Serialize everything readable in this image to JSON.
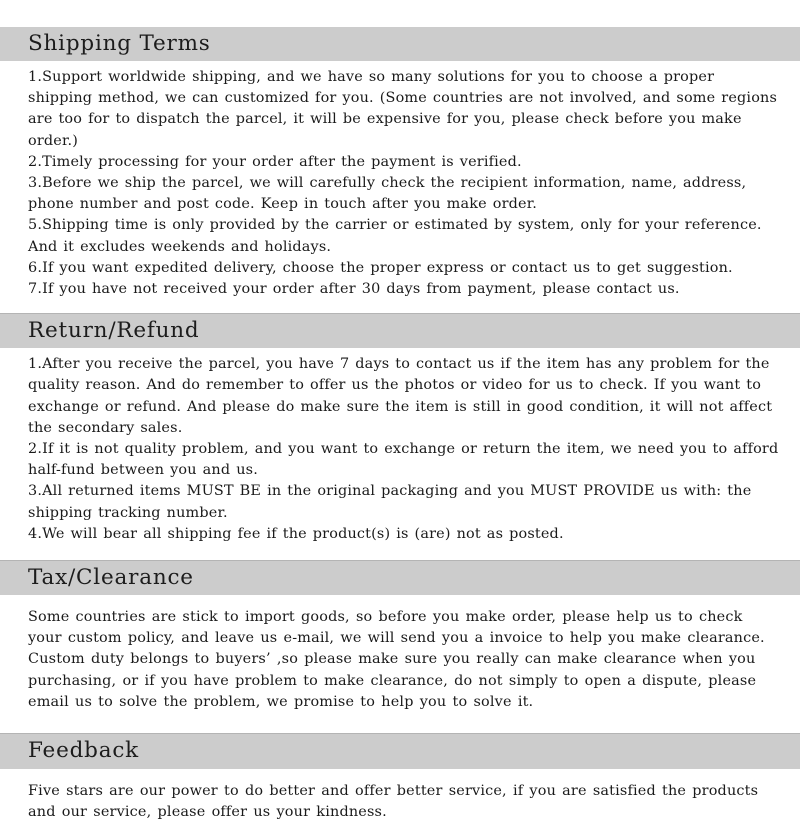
{
  "theme": {
    "header_band_color": "#cccccc",
    "page_background": "#ffffff",
    "text_color": "#1a1a1a",
    "rule_color": "#b4b4b4"
  },
  "document": {
    "sections": [
      {
        "id": "shipping-terms",
        "title": "Shipping Terms",
        "paragraphs": [
          "1.Support worldwide shipping, and we have so many solutions for you to choose a proper shipping method, we can customized for you. (Some countries are not involved, and some regions are too for to dispatch the parcel, it will be expensive for you, please check before you make order.)",
          "2.Timely processing for your order after the payment is verified.",
          "3.Before we ship the parcel, we will carefully check the recipient information, name, address, phone number and post code. Keep in touch after you make order.",
          "5.Shipping time is only provided by the carrier or estimated by system, only for your reference. And it excludes weekends and holidays.",
          "6.If you want expedited delivery, choose the proper express or contact us to get suggestion.",
          "7.If you have not received your order after 30 days from payment, please contact us."
        ]
      },
      {
        "id": "return-refund",
        "title": "Return/Refund",
        "paragraphs": [
          "1.After you receive the parcel, you have 7 days to contact us if the item has any problem for the quality reason. And do remember to offer us the photos or video for us to check. If you want to exchange or refund. And please do make sure the item is still in good condition, it will not affect the secondary sales.",
          "2.If it is not quality problem, and you want to exchange or return the item, we need you to afford half-fund between you and us.",
          "3.All returned items MUST BE in the original packaging and you MUST PROVIDE us with: the shipping tracking number.",
          "4.We will bear all shipping fee if the product(s) is (are) not as posted."
        ]
      },
      {
        "id": "tax-clearance",
        "title": "Tax/Clearance",
        "paragraphs": [
          "Some countries are stick to import goods, so before you make order, please help us to check your custom policy, and leave us e-mail, we will send you a invoice to help you make clearance. Custom duty belongs to buyers’ ,so please make sure you really can make clearance when you purchasing, or if you have problem to make clearance, do not simply to open a dispute, please email us to solve the problem, we promise to help you to solve it."
        ]
      },
      {
        "id": "feedback",
        "title": "Feedback",
        "paragraphs": [
          "Five stars are our power to do better and offer better service, if you are satisfied the products and our service, please offer us your kindness."
        ]
      }
    ]
  }
}
